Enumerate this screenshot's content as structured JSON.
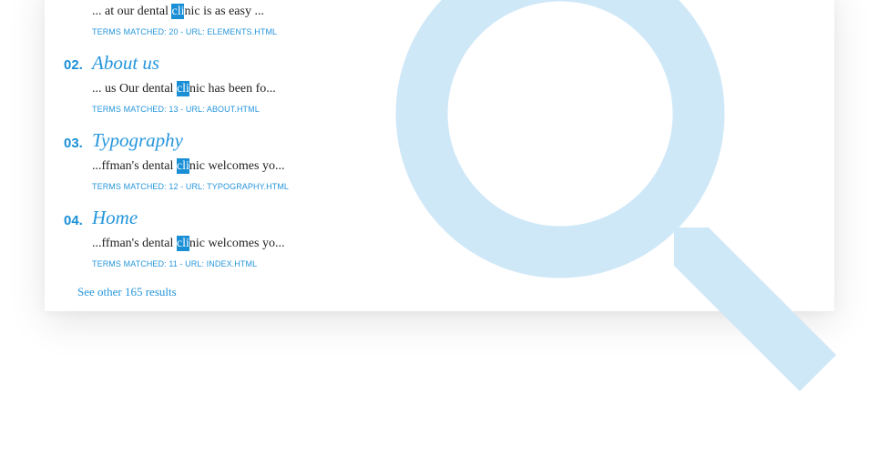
{
  "results": [
    {
      "before": "... at our dental ",
      "highlight": "cli",
      "after": "nic is as easy ...",
      "meta": "TERMS MATCHED: 20 - URL: ELEMENTS.HTML"
    },
    {
      "number": "02.",
      "title": "About us",
      "before": "... us Our dental ",
      "highlight": "cli",
      "after": "nic has been fo...",
      "meta": "TERMS MATCHED: 13 - URL: ABOUT.HTML"
    },
    {
      "number": "03.",
      "title": "Typography",
      "before": "...ffman's dental ",
      "highlight": "cli",
      "after": "nic welcomes yo...",
      "meta": "TERMS MATCHED: 12 - URL: TYPOGRAPHY.HTML"
    },
    {
      "number": "04.",
      "title": "Home",
      "before": "...ffman's dental ",
      "highlight": "cli",
      "after": "nic welcomes yo...",
      "meta": "TERMS MATCHED: 11 - URL: INDEX.HTML"
    }
  ],
  "see_more": "See other 165 results",
  "colors": {
    "accent": "#2696dc",
    "highlight_bg": "#1a8fd6",
    "magnifier": "#cfe8f8",
    "text": "#222222"
  },
  "decor": {
    "background_icon": "magnifier-icon"
  }
}
